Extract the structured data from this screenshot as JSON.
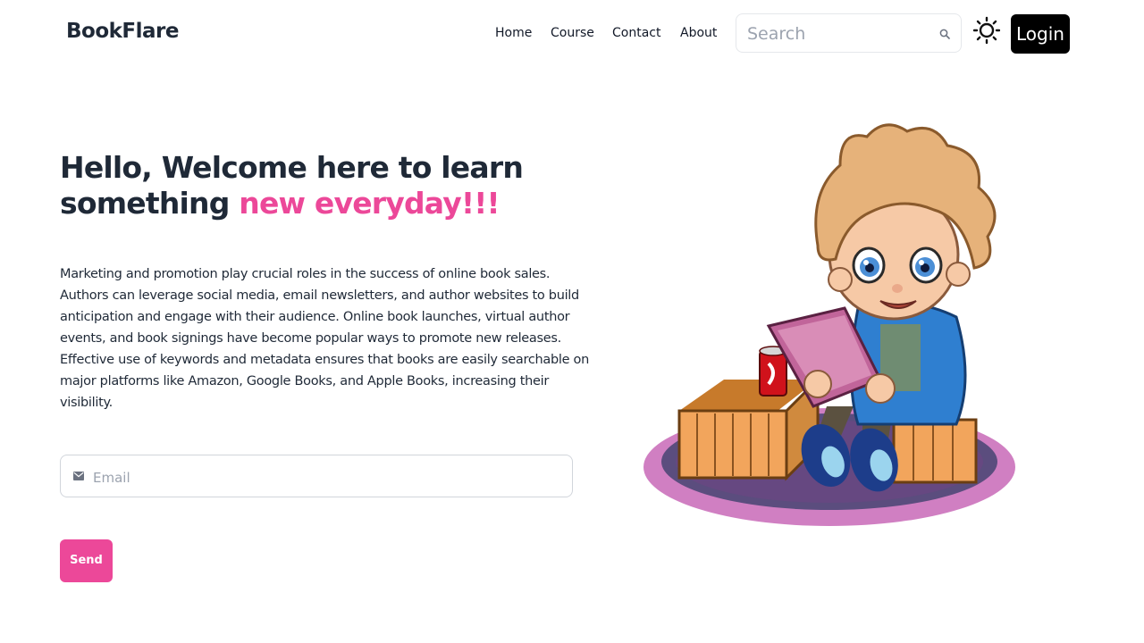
{
  "brand": "BookFlare",
  "nav": {
    "items": [
      {
        "label": "Home"
      },
      {
        "label": "Course"
      },
      {
        "label": "Contact"
      },
      {
        "label": "About"
      }
    ],
    "search_placeholder": "Search",
    "login_label": "Login"
  },
  "hero": {
    "title_line1": "Hello, Welcome here to learn",
    "title_line2_prefix": "something ",
    "title_highlight": "new everyday!!!",
    "description": "Marketing and promotion play crucial roles in the success of online book sales. Authors can leverage social media, email newsletters, and author websites to build anticipation and engage with their audience. Online book launches, virtual author events, and book signings have become popular ways to promote new releases. Effective use of keywords and metadata ensures that books are easily searchable on major platforms like Amazon, Google Books, and Apple Books, increasing their visibility.",
    "email_placeholder": "Email",
    "send_label": "Send"
  },
  "colors": {
    "accent": "#ec4899",
    "text": "#1f2937",
    "login_bg": "#000000"
  },
  "icons": {
    "search": "search-icon",
    "theme": "sun-icon",
    "email": "envelope-icon"
  }
}
